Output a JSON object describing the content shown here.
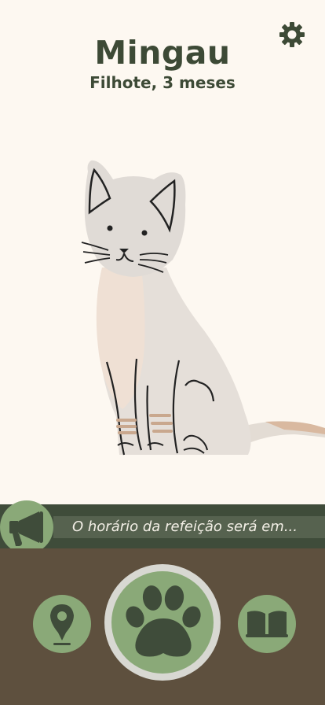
{
  "pet": {
    "name": "Mingau",
    "info": "Filhote, 3 meses"
  },
  "banner": {
    "message": "O horário da refeição será em..."
  },
  "icons": {
    "settings": "gear-icon",
    "announcement": "megaphone-icon",
    "location": "map-pin-icon",
    "feed": "paw-icon",
    "guide": "open-book-icon"
  },
  "colors": {
    "background": "#fdf8f1",
    "text": "#3d4a36",
    "banner": "#3f4c3a",
    "accent_green": "#8aa978",
    "dark_green": "#3f4c3a",
    "bottom_panel": "#5e503e"
  }
}
